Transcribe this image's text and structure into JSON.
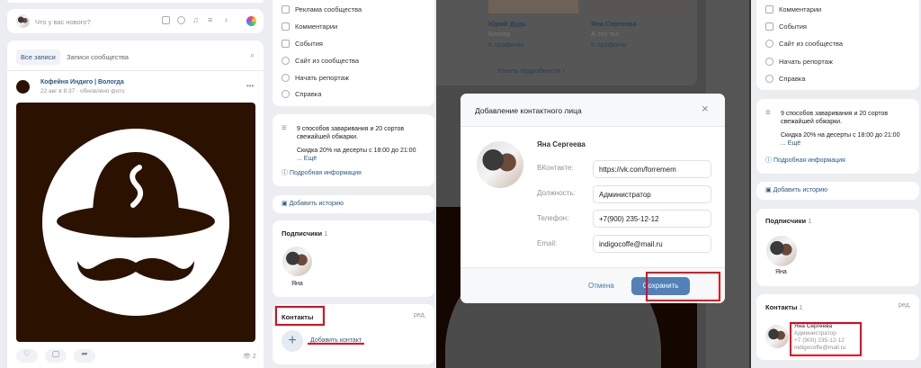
{
  "panel1": {
    "composer": {
      "placeholder": "Что у вас нового?"
    },
    "tabs": [
      "Все записи",
      "Записи сообщества"
    ],
    "post": {
      "author": "Кофейня Индиго | Вологда",
      "meta": "22 авг в 8:37 · обновлено фото",
      "views": "2"
    }
  },
  "panel2": {
    "menu": [
      "Реклама сообщества",
      "Комментарии",
      "События",
      "Сайт из сообщества",
      "Начать репортаж",
      "Справка"
    ],
    "description": {
      "line1": "9 способов заваривания и 20 сортов",
      "line2": "свежайшей обжарки.",
      "line3": "Скидка 20% на десерты с 18:00 до 21:00",
      "more": "... Ещё",
      "info": "Подробная информация"
    },
    "story": "Добавить историю",
    "subscribers": {
      "title": "Подписчики",
      "count": "1",
      "name": "Яна"
    },
    "contacts": {
      "title": "Контакты",
      "edit": "ред.",
      "add": "Добавить контакт"
    }
  },
  "panel3": {
    "bg": {
      "person1": "Юрий Дудь",
      "role1": "Блогер",
      "person2": "Яна Сергеева",
      "role2": "А это ты!",
      "profile": "К профилю",
      "more": "Узнать подробности ›"
    },
    "modal": {
      "title": "Добавление контактного лица",
      "name": "Яна Сергеева",
      "fields": [
        {
          "label": "ВКонтакте:",
          "value": "https://vk.com/forremem"
        },
        {
          "label": "Должность:",
          "value": "Администратор"
        },
        {
          "label": "Телефон:",
          "value": "+7(900) 235-12-12"
        },
        {
          "label": "Email:",
          "value": "indigocoffe@mail.ru"
        }
      ],
      "cancel": "Отмена",
      "save": "Сохранить"
    }
  },
  "panel4": {
    "menu": [
      "Комментарии",
      "События",
      "Сайт из сообщества",
      "Начать репортаж",
      "Справка"
    ],
    "contacts": {
      "title": "Контакты",
      "count": "1",
      "edit": "ред.",
      "name": "Яна Сергеева",
      "role": "Администратор",
      "phone": "+7 (900) 235-12-12",
      "email": "indigocoffe@mail.ru"
    }
  }
}
